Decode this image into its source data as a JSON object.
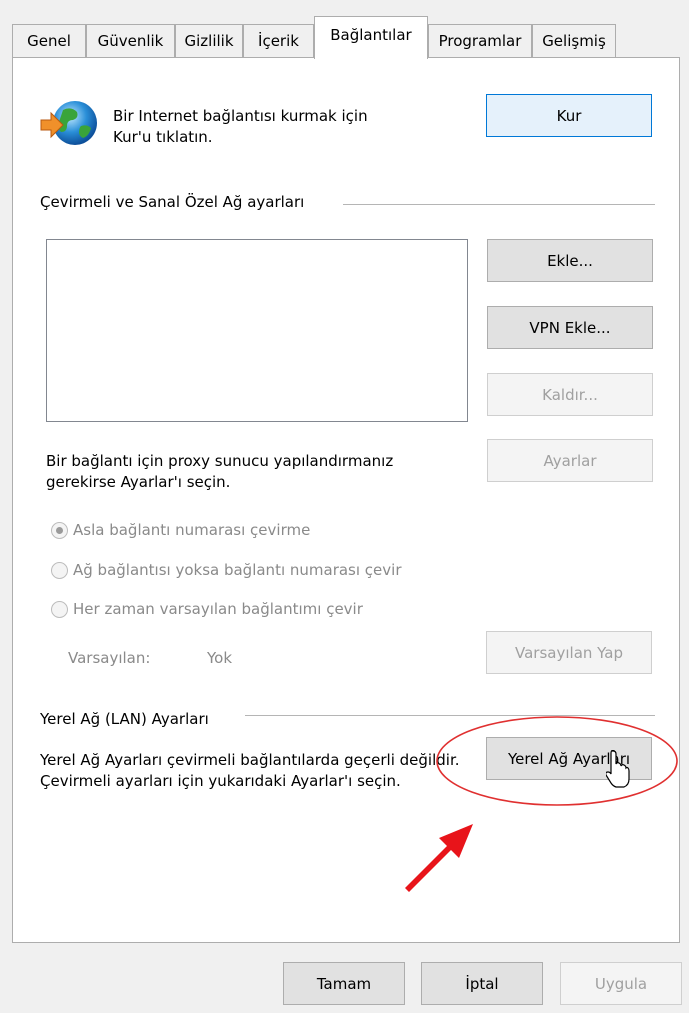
{
  "tabs": [
    {
      "label": "Genel"
    },
    {
      "label": "Güvenlik"
    },
    {
      "label": "Gizlilik"
    },
    {
      "label": "İçerik"
    },
    {
      "label": "Bağlantılar"
    },
    {
      "label": "Programlar"
    },
    {
      "label": "Gelişmiş"
    }
  ],
  "setup": {
    "text": "Bir Internet bağlantısı kurmak için Kur'u tıklatın.",
    "button": "Kur"
  },
  "dialup": {
    "heading": "Çevirmeli ve Sanal Özel Ağ ayarları",
    "add_button": "Ekle...",
    "add_vpn_button": "VPN Ekle...",
    "remove_button": "Kaldır...",
    "proxy_text": "Bir bağlantı için proxy sunucu yapılandırmanız gerekirse Ayarlar'ı seçin.",
    "settings_button": "Ayarlar",
    "radio_never": "Asla bağlantı numarası çevirme",
    "radio_no_network": "Ağ bağlantısı yoksa bağlantı numarası çevir",
    "radio_always": "Her zaman varsayılan bağlantımı çevir",
    "default_label": "Varsayılan:",
    "default_value": "Yok",
    "set_default_button": "Varsayılan Yap"
  },
  "lan": {
    "heading": "Yerel Ağ (LAN) Ayarları",
    "text": "Yerel Ağ Ayarları çevirmeli bağlantılarda geçerli değildir. Çevirmeli ayarları için yukarıdaki Ayarlar'ı seçin.",
    "button": "Yerel Ağ Ayarları"
  },
  "footer": {
    "ok": "Tamam",
    "cancel": "İptal",
    "apply": "Uygula"
  },
  "colors": {
    "highlight_ellipse": "#e03030",
    "arrow": "#e8141a",
    "default_button_border": "#0078d7"
  },
  "icons": {
    "setup": "globe-arrow-icon",
    "cursor": "mouse-pointer-icon"
  }
}
